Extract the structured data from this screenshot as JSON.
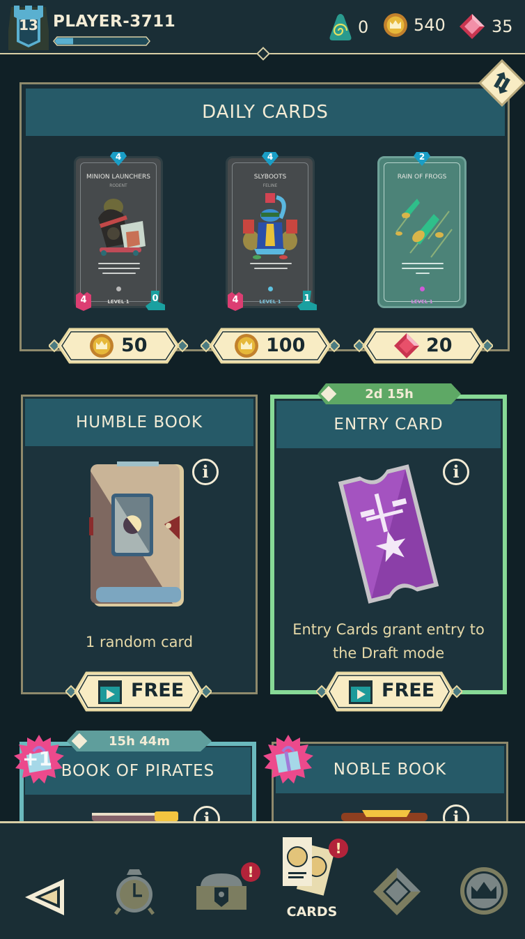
{
  "player": {
    "level": "13",
    "name": "PLAYER-3711",
    "xp_progress": 0.18
  },
  "currencies": [
    {
      "name": "token",
      "icon": "spiral-token-icon",
      "value": "0"
    },
    {
      "name": "gold",
      "icon": "crown-coin-icon",
      "value": "540"
    },
    {
      "name": "gems",
      "icon": "ruby-gem-icon",
      "value": "35"
    }
  ],
  "daily": {
    "title": "DAILY CARDS",
    "swap_icon": "swap-arrows-icon",
    "cards": [
      {
        "title": "MINION LAUNCHERS",
        "tribe": "RODENT",
        "cost": "4",
        "attack": "4",
        "health": "0",
        "level": "LEVEL 1",
        "rarity_color": "#b8b8b8",
        "type": "unit",
        "price": "50",
        "currency": "gold"
      },
      {
        "title": "SLYBOOTS",
        "tribe": "FELINE",
        "cost": "4",
        "attack": "4",
        "health": "1",
        "level": "LEVEL 1",
        "rarity_color": "#5ec2e0",
        "type": "unit",
        "price": "100",
        "currency": "gold"
      },
      {
        "title": "RAIN OF FROGS",
        "tribe": "",
        "cost": "2",
        "attack": "",
        "health": "",
        "level": "LEVEL 1",
        "rarity_color": "#d05ad8",
        "type": "spell",
        "price": "20",
        "currency": "gems"
      }
    ]
  },
  "offers": [
    {
      "title": "HUMBLE BOOK",
      "description": "1 random card",
      "button": "FREE",
      "timer": ""
    },
    {
      "title": "ENTRY CARD",
      "description": "Entry Cards grant entry to the Draft mode",
      "button": "FREE",
      "timer": "2d 15h"
    },
    {
      "title": "BOOK OF PIRATES",
      "description": "",
      "button": "",
      "timer": "15h 44m",
      "gift_badge": "+1"
    },
    {
      "title": "NOBLE BOOK",
      "description": "",
      "button": "",
      "timer": "",
      "gift_badge": ""
    }
  ],
  "nav": {
    "items": [
      {
        "name": "back",
        "icon": "back-triangle-icon",
        "label": "",
        "alert": ""
      },
      {
        "name": "timer",
        "icon": "alarm-clock-icon",
        "label": "",
        "alert": ""
      },
      {
        "name": "chest",
        "icon": "treasure-chest-icon",
        "label": "",
        "alert": "!"
      },
      {
        "name": "cards",
        "icon": "cards-icon",
        "label": "CARDS",
        "alert": "!",
        "active": true
      },
      {
        "name": "gem",
        "icon": "diamond-icon",
        "label": "",
        "alert": ""
      },
      {
        "name": "crown",
        "icon": "crown-badge-icon",
        "label": "",
        "alert": ""
      }
    ]
  },
  "colors": {
    "background": "#102026",
    "panel_header": "#265a68",
    "accent_cream": "#f8ecc4",
    "timer_green": "#5ea865",
    "timer_teal": "#5f9e9c",
    "alert_red": "#b3233a"
  }
}
